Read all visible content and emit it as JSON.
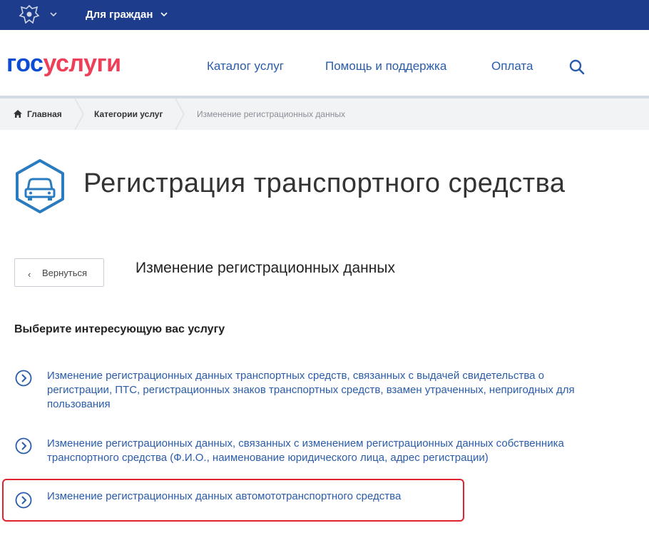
{
  "topbar": {
    "audience_label": "Для граждан"
  },
  "header": {
    "logo_part1": "гос",
    "logo_part2": "услуги",
    "nav": [
      "Каталог услуг",
      "Помощь и поддержка",
      "Оплата"
    ]
  },
  "breadcrumb": {
    "home": "Главная",
    "categories": "Категории услуг",
    "current": "Изменение регистрационных данных"
  },
  "page": {
    "title": "Регистрация транспортного средства",
    "back_label": "Вернуться",
    "subtitle": "Изменение регистрационных данных",
    "section_heading": "Выберите интересующую вас услугу"
  },
  "options": [
    {
      "line1": "Изменение регистрационных данных транспортных средств, связанных с выдачей свидетельства о",
      "line2": "регистрации, ПТС, регистрационных знаков транспортных средств, взамен утраченных, непригодных для",
      "line3": "пользования"
    },
    {
      "line1": "Изменение регистрационных данных, связанных с изменением регистрационных данных собственника",
      "line2": "транспортного средства (Ф.И.О., наименование юридического лица, адрес регистрации)"
    },
    {
      "line1": "Изменение регистрационных данных автомототранспортного средства",
      "highlighted": true
    }
  ],
  "colors": {
    "topbar": "#1e3c8c",
    "link": "#2a5caa",
    "highlight": "#e0242e",
    "logo_blue": "#0d4cd3",
    "logo_red": "#ee3f58"
  }
}
